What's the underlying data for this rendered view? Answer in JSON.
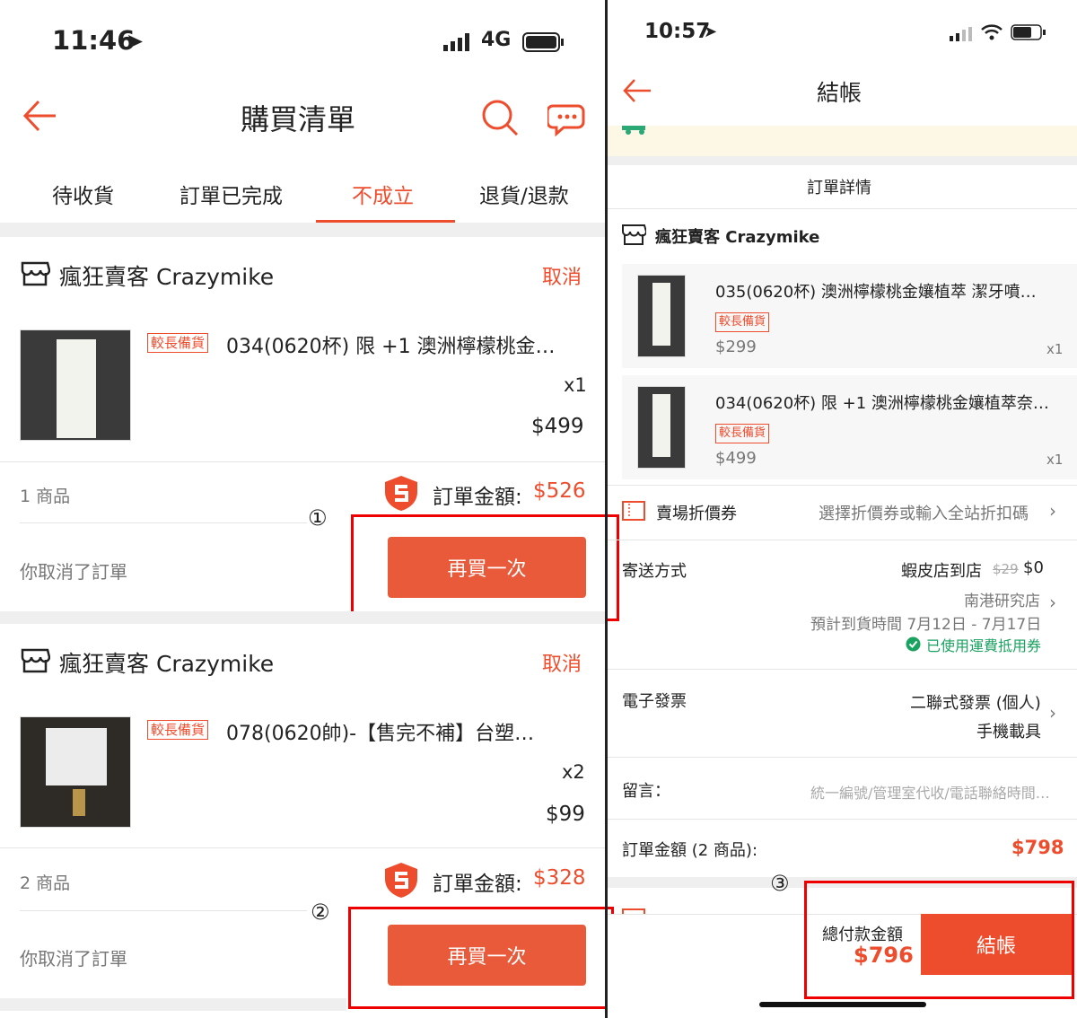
{
  "left": {
    "status_time": "11:46",
    "network": "4G",
    "title": "購買清單",
    "tabs": [
      "待收貨",
      "訂單已完成",
      "不成立",
      "退貨/退款"
    ],
    "orders": [
      {
        "shop": "瘋狂賣客 Crazymike",
        "cancel": "取消",
        "tag": "較長備貨",
        "product": "034(0620杯) 限 +1 澳洲檸檬桃金…",
        "qty": "x1",
        "price": "$499",
        "count": "1 商品",
        "total_label": "訂單金額:",
        "total": "$526",
        "note": "你取消了訂單",
        "marker": "①",
        "button": "再買一次"
      },
      {
        "shop": "瘋狂賣客 Crazymike",
        "cancel": "取消",
        "tag": "較長備貨",
        "product": "078(0620帥)-【售完不補】台塑…",
        "qty": "x2",
        "price": "$99",
        "count": "2 商品",
        "total_label": "訂單金額:",
        "total": "$328",
        "note": "你取消了訂單",
        "marker": "②",
        "button": "再買一次"
      }
    ]
  },
  "right": {
    "status_time": "10:57",
    "title": "結帳",
    "section_title": "訂單詳情",
    "shop": "瘋狂賣客 Crazymike",
    "items": [
      {
        "name": "035(0620杯) 澳洲檸檬桃金孃植萃 潔牙噴…",
        "tag": "較長備貨",
        "price": "$299",
        "qty": "x1"
      },
      {
        "name": "034(0620杯) 限 +1 澳洲檸檬桃金孃植萃奈…",
        "tag": "較長備貨",
        "price": "$499",
        "qty": "x1"
      }
    ],
    "voucher_label": "賣場折價券",
    "voucher_value": "選擇折價券或輸入全站折扣碼",
    "shipping_label": "寄送方式",
    "shipping_method": "蝦皮店到店",
    "shipping_old": "$29",
    "shipping_new": "$0",
    "shipping_store": "南港研究店",
    "shipping_eta": "預計到貨時間 7月12日 - 7月17日",
    "shipping_coupon": "已使用運費抵用券",
    "invoice_label": "電子發票",
    "invoice_type": "二聯式發票 (個人)",
    "invoice_carrier": "手機載具",
    "message_label": "留言：",
    "message_placeholder": "統一編號/管理室代收/電話聯絡時間…",
    "order_total_label": "訂單金額 (2 商品):",
    "order_total": "$798",
    "marker": "③",
    "pay_label": "總付款金額",
    "pay_total": "$796",
    "checkout": "結帳"
  },
  "colors": {
    "accent": "#ee4d2d",
    "highlight": "#e00000",
    "coupon_green": "#1aa260"
  }
}
